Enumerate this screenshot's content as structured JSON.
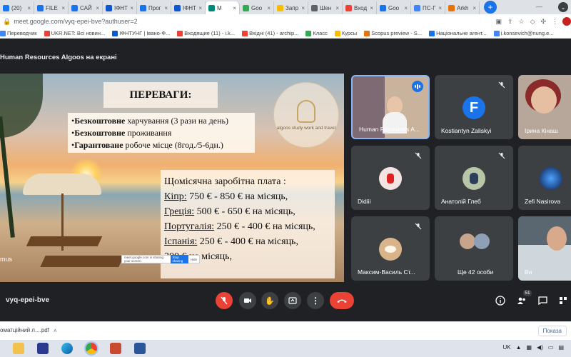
{
  "browser": {
    "tabs": [
      {
        "label": "(20)",
        "color": "#1877f2"
      },
      {
        "label": "FILE",
        "color": "#1a73e8"
      },
      {
        "label": "САЙ",
        "color": "#1a73e8"
      },
      {
        "label": "ІФНТ",
        "color": "#0b57d0"
      },
      {
        "label": "Прог",
        "color": "#1a73e8"
      },
      {
        "label": "ІФНТ",
        "color": "#0b57d0"
      },
      {
        "label": "M",
        "color": "#00897b",
        "active": true
      },
      {
        "label": "Goo",
        "color": "#34a853"
      },
      {
        "label": "Запр",
        "color": "#fbbc04"
      },
      {
        "label": "Шен",
        "color": "#5f6368"
      },
      {
        "label": "Вход",
        "color": "#ea4335"
      },
      {
        "label": "Goo",
        "color": "#1a73e8"
      },
      {
        "label": "ПС-Г",
        "color": "#4285f4"
      },
      {
        "label": "Arkh",
        "color": "#e8710a"
      }
    ],
    "new_tab": "+",
    "url": "meet.google.com/vyq-epei-bve?authuser=2",
    "bookmarks": [
      {
        "label": "Переводчик",
        "color": "#4285f4"
      },
      {
        "label": "UKR.NET: Всі новин...",
        "color": "#ea4335"
      },
      {
        "label": "ІФНТУНГ | Івано-Ф...",
        "color": "#0b57d0"
      },
      {
        "label": "Входящие (11) - i.k...",
        "color": "#ea4335"
      },
      {
        "label": "Вхідні (41) - archip...",
        "color": "#ea4335"
      },
      {
        "label": "Класс",
        "color": "#34a853"
      },
      {
        "label": "Курсы",
        "color": "#fbbc04"
      },
      {
        "label": "Scopus preview - S...",
        "color": "#e8710a"
      },
      {
        "label": "Національне агент...",
        "color": "#1a73e8"
      },
      {
        "label": "i.konsevich@nung.e...",
        "color": "#4285f4"
      }
    ]
  },
  "meet": {
    "presenting_title": "Human Resources Algoos на екрані",
    "slide": {
      "heading": "ПЕРЕВАГИ:",
      "benefits": [
        {
          "bold": "Безкоштовне",
          "rest": " харчування (3 рази на день)"
        },
        {
          "bold": "Безкоштовне",
          "rest": " проживання"
        },
        {
          "bold": "Гарантоване",
          "rest": " робоче місце (8год./5-6дн.)"
        }
      ],
      "salary_title": "Щомісячна заробітна плата :",
      "salary_rows": [
        {
          "country": "Кіпр:",
          "amount": " 750 € - 850 € на місяць,"
        },
        {
          "country": "Греція:",
          "amount": "  500 € - 650 € на місяць,"
        },
        {
          "country": "Португалія:",
          "amount": " 250 € - 400 € на місяць,"
        },
        {
          "country": "Іспанія:",
          "amount": " 250 € - 400 € на місяць,"
        },
        {
          "country": "",
          "amount": "300 € на місяць,"
        }
      ],
      "logo_text": "algoos study work and travel",
      "popup_text": "meet.google.com is sharing your screen.",
      "popup_btn": "Stop sharing",
      "popup_hide": "Hide",
      "presenter_label": "mus"
    },
    "participants": [
      {
        "name": "Human Resources A...",
        "speaking": true
      },
      {
        "name": "Kostiantyn Zaliskyi",
        "initial": "F",
        "color": "#1a73e8"
      },
      {
        "name": "Ірина Кінаш"
      },
      {
        "name": "Didiii"
      },
      {
        "name": "Анатолій Глеб"
      },
      {
        "name": "Zefi Nasirova"
      },
      {
        "name": "Максим-Василь Ст..."
      },
      {
        "name": "Ще 42 особи"
      },
      {
        "name": "Ви"
      }
    ],
    "meeting_code": "vyq-epei-bve",
    "participant_count": "51"
  },
  "downloads": {
    "file": "оматційний л....pdf",
    "show_all": "Показа"
  },
  "taskbar": {
    "lang": "UK"
  }
}
